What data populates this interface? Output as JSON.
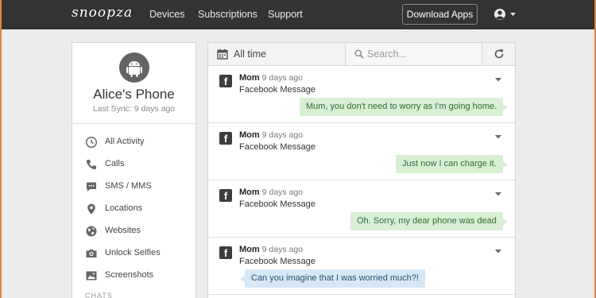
{
  "brand": "snoopza",
  "nav": {
    "devices": "Devices",
    "subscriptions": "Subscriptions",
    "support": "Support"
  },
  "download_apps": "Download Apps",
  "user_icon": "user-circle-icon",
  "device": {
    "name": "Alice's Phone",
    "last_sync": "Last Sync: 9 days ago",
    "icon": "android-icon"
  },
  "menu": [
    {
      "label": "All Activity",
      "icon": "clock-icon"
    },
    {
      "label": "Calls",
      "icon": "phone-icon"
    },
    {
      "label": "SMS / MMS",
      "icon": "sms-icon"
    },
    {
      "label": "Locations",
      "icon": "map-pin-icon"
    },
    {
      "label": "Websites",
      "icon": "globe-icon"
    },
    {
      "label": "Unlock Selfies",
      "icon": "camera-icon"
    },
    {
      "label": "Screenshots",
      "icon": "image-icon"
    }
  ],
  "chats_header": "CHATS",
  "toolbar": {
    "filter_label": "All time",
    "search_placeholder": "Search..."
  },
  "messages": [
    {
      "sender": "Mom",
      "time": "9 days ago",
      "type": "Facebook Message",
      "text": "Mum, you don't need to worry as I'm going home.",
      "direction": "outgoing"
    },
    {
      "sender": "Mom",
      "time": "9 days ago",
      "type": "Facebook Message",
      "text": "Just now I can charge it.",
      "direction": "outgoing"
    },
    {
      "sender": "Mom",
      "time": "9 days ago",
      "type": "Facebook Message",
      "text": "Oh. Sorry, my dear phone was dead",
      "direction": "outgoing"
    },
    {
      "sender": "Mom",
      "time": "9 days ago",
      "type": "Facebook Message",
      "text": "Can you imagine that I was worried much?!",
      "direction": "incoming"
    }
  ],
  "colors": {
    "topbar": "#333333",
    "outgoing_bubble": "#d8efd4",
    "incoming_bubble": "#d6e8f5",
    "frame_accent": "#e0833b"
  }
}
